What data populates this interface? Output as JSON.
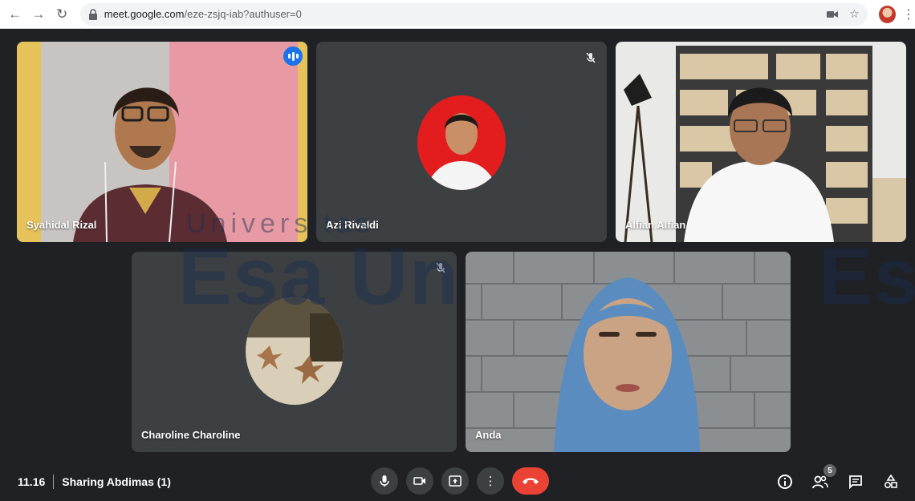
{
  "browser": {
    "url_host": "meet.google.com",
    "url_path": "/eze-zsjq-iab?authuser=0",
    "icons": [
      "back-arrow-icon",
      "forward-arrow-icon",
      "reload-icon",
      "lock-icon",
      "camera-icon",
      "star-icon",
      "profile-avatar",
      "kebab-menu-icon"
    ]
  },
  "watermark": {
    "line1": "Universitas",
    "line2": "Esa Un",
    "line3": "Es"
  },
  "participants": [
    {
      "name": "Syahidal Rizal",
      "state": "speaking"
    },
    {
      "name": "Azi Rivaldi",
      "state": "muted"
    },
    {
      "name": "Alfian Alfian",
      "state": "video"
    },
    {
      "name": "Charoline Charoline",
      "state": "muted"
    },
    {
      "name": "Anda",
      "state": "video"
    }
  ],
  "bottom_bar": {
    "time": "11.16",
    "meeting_title": "Sharing Abdimas (1)",
    "people_count": "5"
  },
  "colors": {
    "background": "#202124",
    "tile": "#3c4043",
    "accent": "#1a73e8",
    "end_call": "#ea4335",
    "active_outline": "#8ab4f8"
  }
}
